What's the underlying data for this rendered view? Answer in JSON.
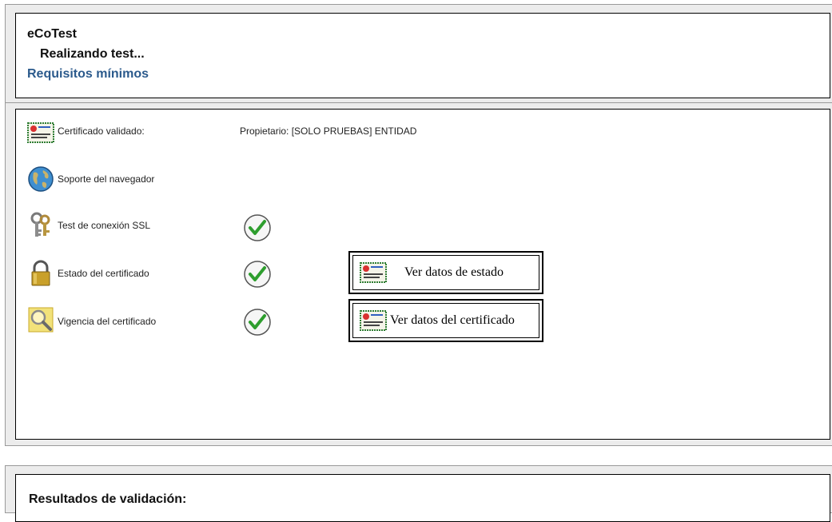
{
  "header": {
    "app_title": "eCoTest",
    "status": "Realizando test...",
    "requirements_link": "Requisitos mínimos"
  },
  "checks": {
    "certificate": {
      "label": "Certificado validado:",
      "value": "Propietario: [SOLO PRUEBAS] ENTIDAD",
      "icon": "certificate-icon"
    },
    "browser": {
      "label": "Soporte del navegador",
      "icon": "globe-icon"
    },
    "ssl": {
      "label": "Test de conexión SSL",
      "icon": "keys-icon",
      "status_icon": "check-icon"
    },
    "cert_state": {
      "label": "Estado del certificado",
      "icon": "padlock-icon",
      "status_icon": "check-icon",
      "button": "Ver datos de estado"
    },
    "cert_validity": {
      "label": "Vigencia del certificado",
      "icon": "magnifier-icon",
      "status_icon": "check-icon",
      "button": "Ver datos del certificado"
    }
  },
  "results": {
    "title": "Resultados de validación:"
  },
  "colors": {
    "link": "#2b5a8c",
    "panel_bg": "#ececec",
    "check_green": "#2e9e2e"
  }
}
